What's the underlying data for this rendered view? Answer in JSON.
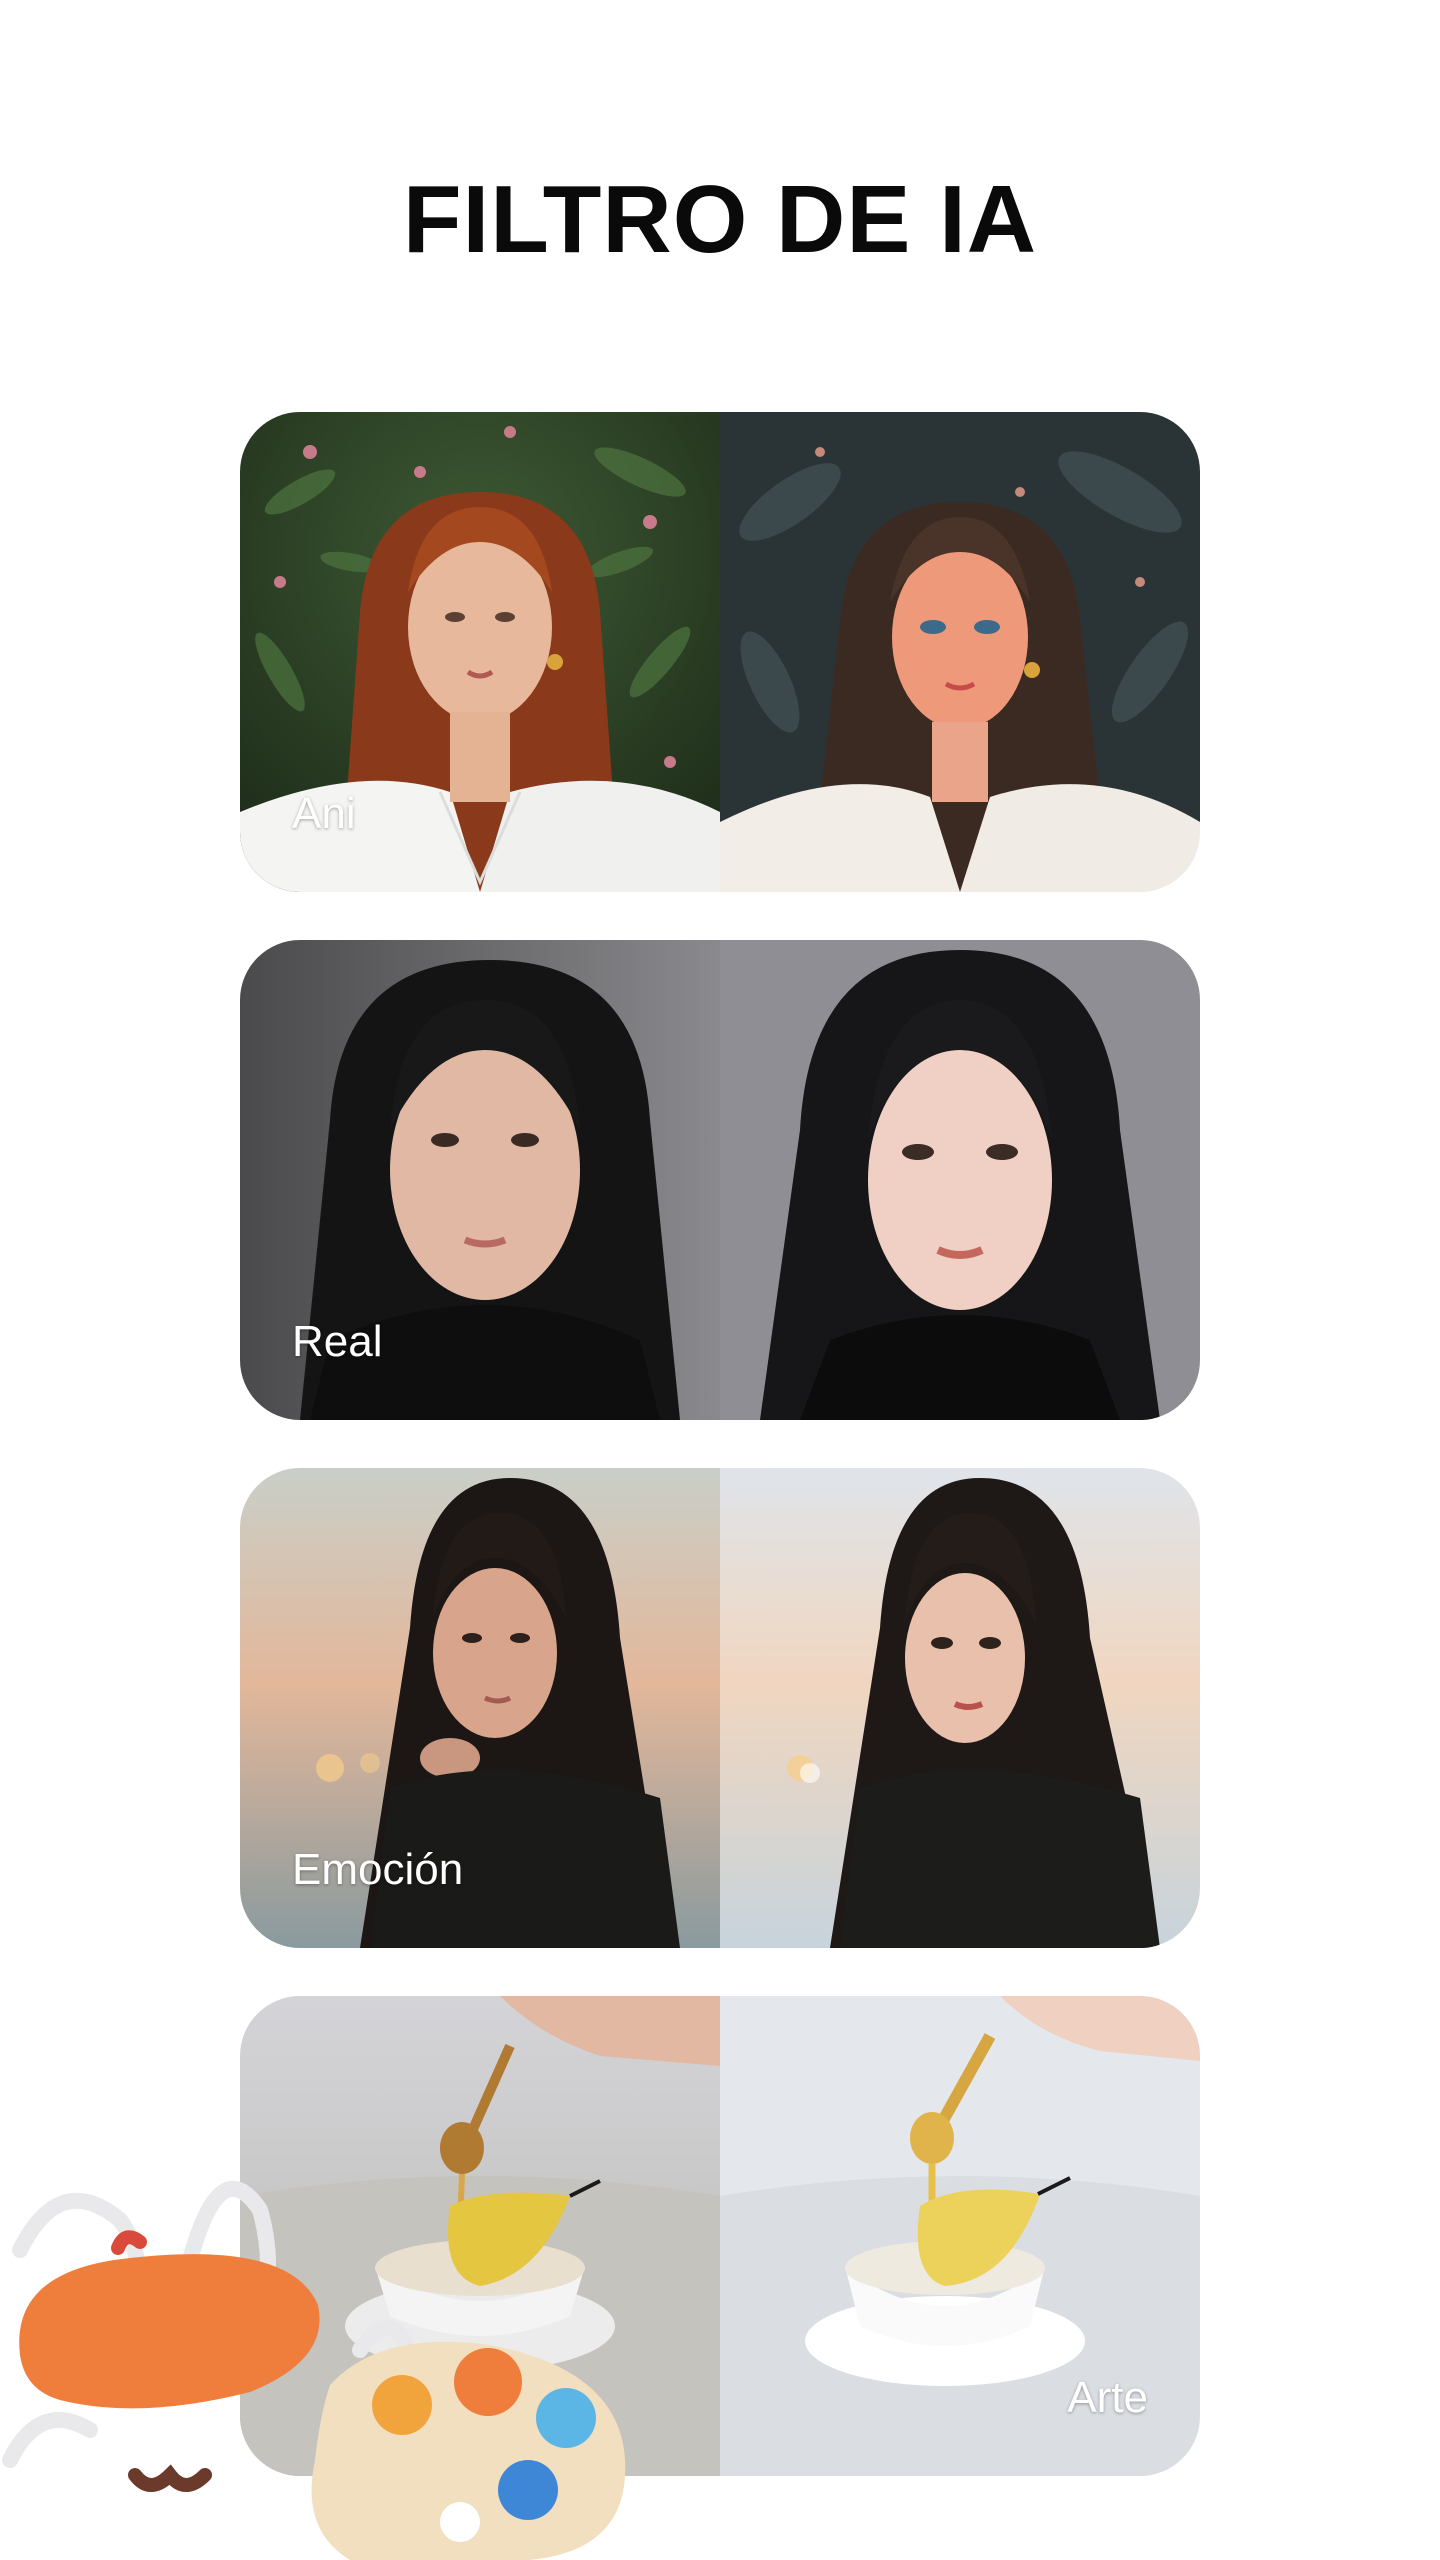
{
  "header": {
    "title": "FILTRO DE IA"
  },
  "cards": [
    {
      "label": "Ani"
    },
    {
      "label": "Real"
    },
    {
      "label": "Emoción"
    },
    {
      "label": "Arte"
    }
  ],
  "colors": {
    "background": "#ffffff",
    "title": "#0a0a0a",
    "label": "#ffffff",
    "beret": "#ef7d3b",
    "palette": "#f2dfc0"
  },
  "icons": {
    "decoration": "painter-palette-icon"
  }
}
